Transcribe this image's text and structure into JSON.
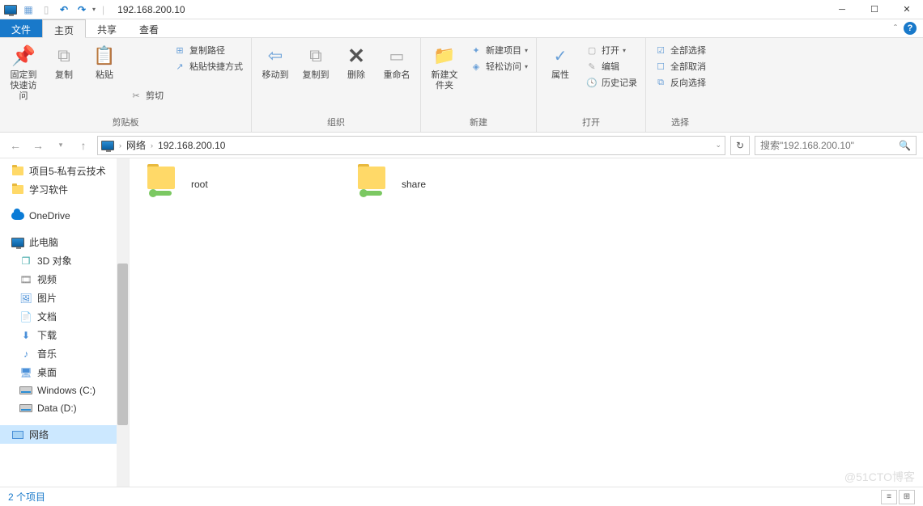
{
  "title": "192.168.200.10",
  "qat_divider": "|",
  "tabs": {
    "file": "文件",
    "home": "主页",
    "share": "共享",
    "view": "查看"
  },
  "ribbon": {
    "clipboard": {
      "pin": "固定到快速访问",
      "copy": "复制",
      "paste": "粘贴",
      "cut": "剪切",
      "copy_path": "复制路径",
      "paste_shortcut": "粘贴快捷方式",
      "label": "剪贴板"
    },
    "organize": {
      "move_to": "移动到",
      "copy_to": "复制到",
      "delete": "删除",
      "rename": "重命名",
      "label": "组织"
    },
    "new": {
      "new_folder": "新建文件夹",
      "new_item": "新建项目",
      "easy_access": "轻松访问",
      "label": "新建"
    },
    "open": {
      "properties": "属性",
      "open": "打开",
      "edit": "编辑",
      "history": "历史记录",
      "label": "打开"
    },
    "select": {
      "select_all": "全部选择",
      "select_none": "全部取消",
      "invert": "反向选择",
      "label": "选择"
    }
  },
  "address": {
    "seg1": "网络",
    "seg2": "192.168.200.10"
  },
  "search_placeholder": "搜索\"192.168.200.10\"",
  "sidebar": {
    "items": [
      {
        "label": "项目5-私有云技术",
        "type": "folder"
      },
      {
        "label": "学习软件",
        "type": "folder"
      },
      {
        "label": "OneDrive",
        "type": "cloud",
        "gap": true
      },
      {
        "label": "此电脑",
        "type": "pc",
        "gap": true
      },
      {
        "label": "3D 对象",
        "type": "3d",
        "indent": true
      },
      {
        "label": "视频",
        "type": "video",
        "indent": true
      },
      {
        "label": "图片",
        "type": "pic",
        "indent": true
      },
      {
        "label": "文档",
        "type": "doc",
        "indent": true
      },
      {
        "label": "下载",
        "type": "dl",
        "indent": true
      },
      {
        "label": "音乐",
        "type": "music",
        "indent": true
      },
      {
        "label": "桌面",
        "type": "desk",
        "indent": true
      },
      {
        "label": "Windows (C:)",
        "type": "drive",
        "indent": true
      },
      {
        "label": "Data (D:)",
        "type": "drive",
        "indent": true
      },
      {
        "label": "网络",
        "type": "net",
        "gap": true,
        "selected": true
      }
    ]
  },
  "content": [
    {
      "name": "root"
    },
    {
      "name": "share"
    }
  ],
  "status": "2 个项目",
  "watermark": "@51CTO博客"
}
